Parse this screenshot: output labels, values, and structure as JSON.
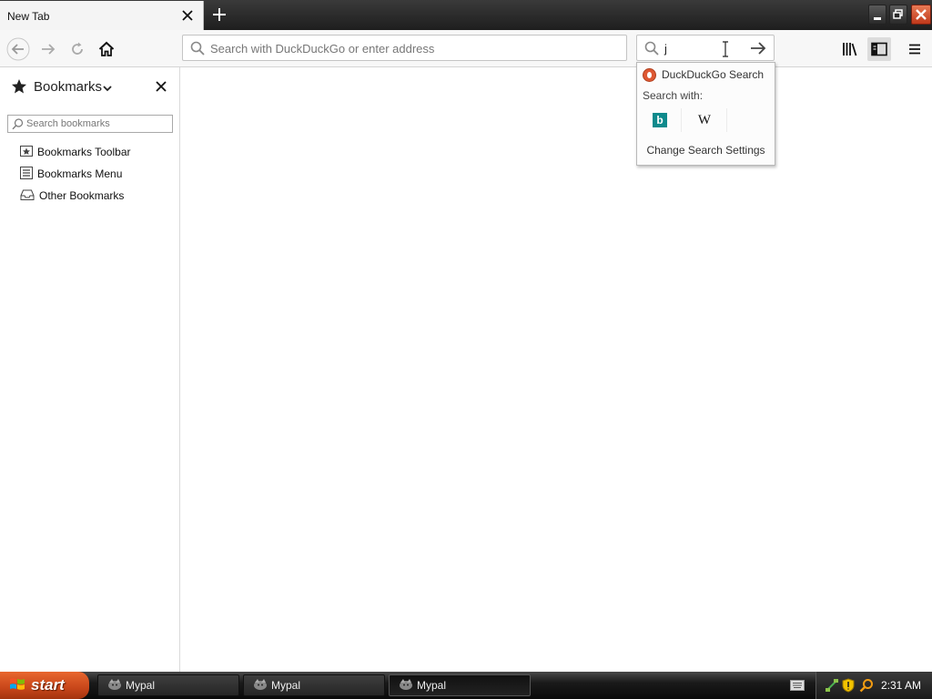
{
  "tab": {
    "title": "New Tab"
  },
  "urlbar": {
    "placeholder": "Search with DuckDuckGo or enter address"
  },
  "searchbar": {
    "value": "j"
  },
  "search_popup": {
    "engine_label": "DuckDuckGo Search",
    "search_with": "Search with:",
    "bing_glyph": "b",
    "wikipedia_glyph": "W",
    "settings_label": "Change Search Settings"
  },
  "sidebar": {
    "title": "Bookmarks",
    "search_placeholder": "Search bookmarks",
    "items": [
      {
        "label": "Bookmarks Toolbar",
        "icon": "bookmarks-toolbar-icon"
      },
      {
        "label": "Bookmarks Menu",
        "icon": "bookmarks-menu-icon"
      },
      {
        "label": "Other Bookmarks",
        "icon": "other-bookmarks-icon"
      }
    ]
  },
  "taskbar": {
    "start_label": "start",
    "tasks": [
      {
        "label": "Mypal",
        "active": false
      },
      {
        "label": "Mypal",
        "active": false
      },
      {
        "label": "Mypal",
        "active": true
      }
    ],
    "clock": "2:31 AM"
  },
  "colors": {
    "start_button": "#c8461a",
    "bing": "#0e8a8c",
    "duckduckgo": "#de5833",
    "window_close": "#c0391b"
  }
}
